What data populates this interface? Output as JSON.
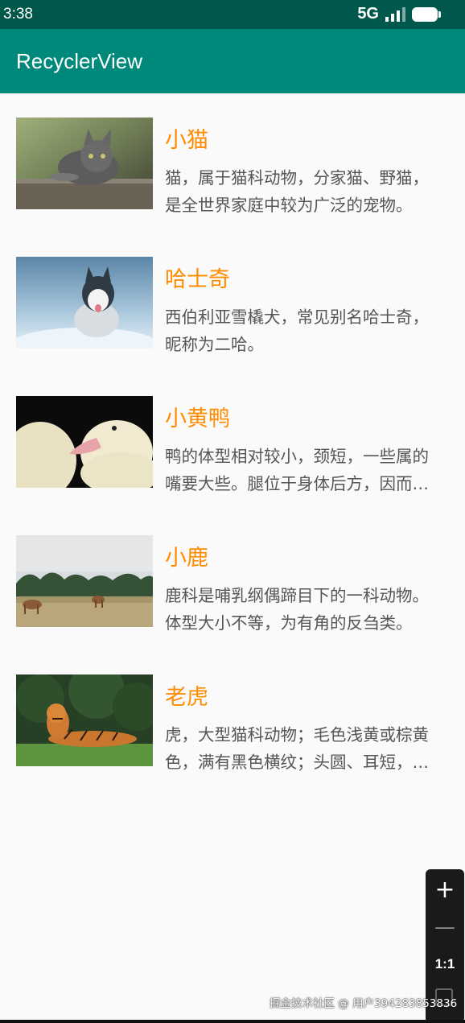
{
  "status_bar": {
    "time": "3:38",
    "network": "5G",
    "icons": [
      "signal-icon",
      "battery-icon"
    ]
  },
  "app_bar": {
    "title": "RecyclerView",
    "color": "#00897b"
  },
  "items": [
    {
      "title": "小猫",
      "desc": "猫，属于猫科动物，分家猫、野猫，是全世界家庭中较为广泛的宠物。",
      "image": "cat-photo"
    },
    {
      "title": "哈士奇",
      "desc": "西伯利亚雪橇犬，常见别名哈士奇，昵称为二哈。",
      "image": "husky-photo"
    },
    {
      "title": "小黄鸭",
      "desc": "鸭的体型相对较小，颈短，一些属的嘴要大些。腿位于身体后方，因而步态蹒跚。",
      "image": "duckling-photo"
    },
    {
      "title": "小鹿",
      "desc": "鹿科是哺乳纲偶蹄目下的一科动物。体型大小不等，为有角的反刍类。",
      "image": "deer-photo"
    },
    {
      "title": "老虎",
      "desc": "虎，大型猫科动物；毛色浅黄或棕黄色，满有黑色横纹；头圆、耳短，耳背面黑色。",
      "image": "tiger-photo"
    }
  ],
  "title_color": "#ff8c00",
  "zoom_control": {
    "plus": "+",
    "minus": "—",
    "ratio": "1:1"
  },
  "watermark": "掘金技术社区 @ 用户3942838538​36"
}
